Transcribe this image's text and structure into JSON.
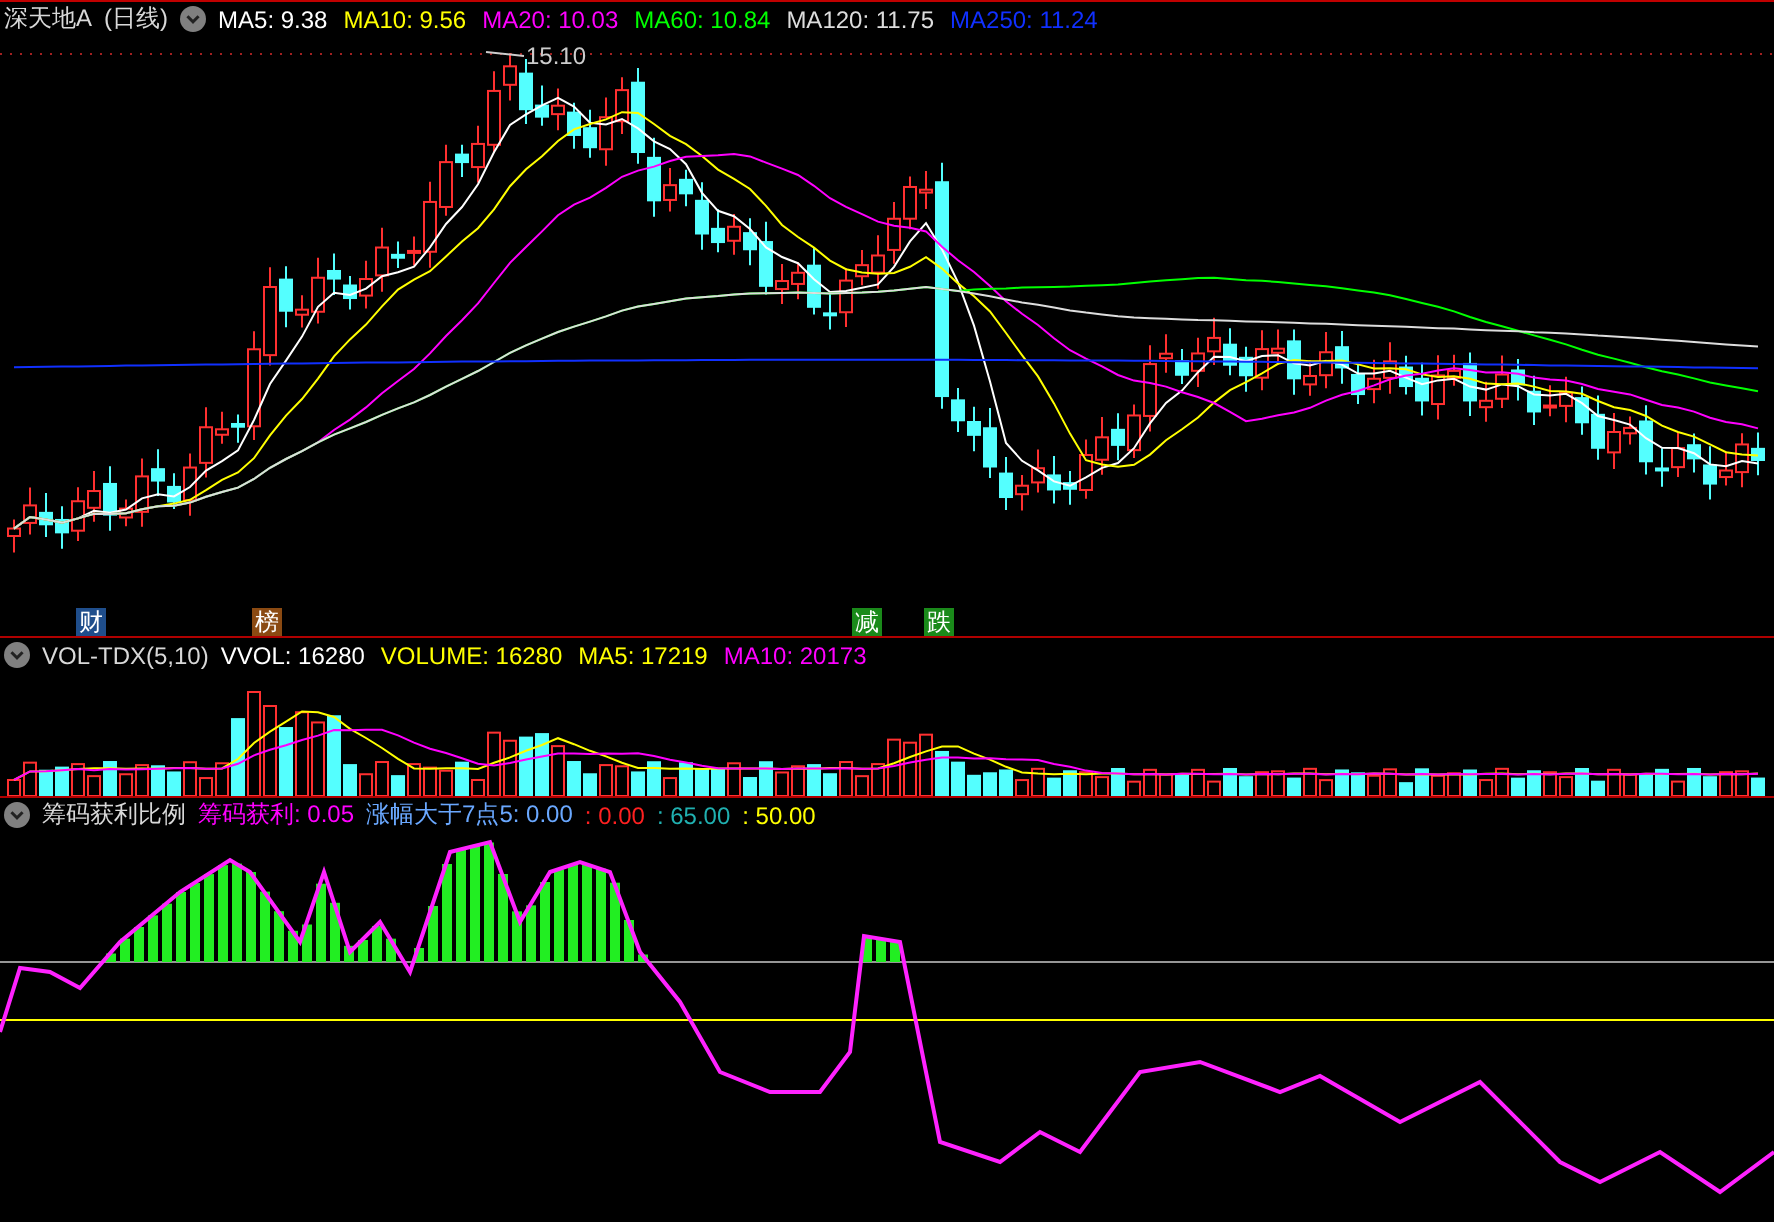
{
  "price_panel": {
    "stock_name": "深天地A",
    "period": "(日线)",
    "high_label": "15.10",
    "indicators": [
      {
        "label": "MA5: 9.38",
        "color": "#ffffff"
      },
      {
        "label": "MA10: 9.56",
        "color": "#ffff00"
      },
      {
        "label": "MA20: 10.03",
        "color": "#ff00ff"
      },
      {
        "label": "MA60: 10.84",
        "color": "#00ff00"
      },
      {
        "label": "MA120: 11.75",
        "color": "#dddddd"
      },
      {
        "label": "MA250: 11.24",
        "color": "#1030ff"
      }
    ],
    "event_markers": [
      {
        "label": "财",
        "color": "#1f4e8c"
      },
      {
        "label": "榜",
        "color": "#8b4a12"
      },
      {
        "label": "减",
        "color": "#1a8a1a"
      },
      {
        "label": "跌",
        "color": "#1a8a1a"
      }
    ]
  },
  "volume_panel": {
    "name": "VOL-TDX(5,10)",
    "indicators": [
      {
        "label": "VVOL: 16280",
        "color": "#ffffff"
      },
      {
        "label": "VOLUME: 16280",
        "color": "#ffff00"
      },
      {
        "label": "MA5: 17219",
        "color": "#ffff00"
      },
      {
        "label": "MA10: 20173",
        "color": "#ff00ff"
      }
    ]
  },
  "chip_panel": {
    "name": "筹码获利比例",
    "indicators": [
      {
        "label": "筹码获利: 0.05",
        "color": "#ff00ff"
      },
      {
        "label": "涨幅大于7点5: 0.00",
        "color": "#6aa8ff"
      },
      {
        "label": ": 0.00",
        "color": "#ff2020"
      },
      {
        "label": ": 65.00",
        "color": "#20b0b0"
      },
      {
        "label": ": 50.00",
        "color": "#ffff00"
      }
    ]
  }
}
